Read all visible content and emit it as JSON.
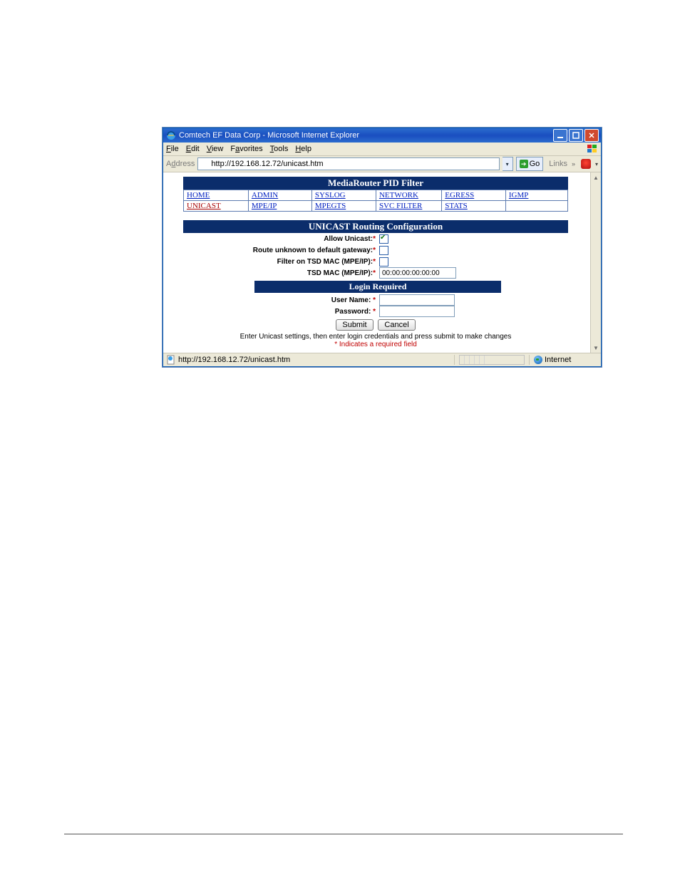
{
  "window": {
    "title": "Comtech EF Data Corp - Microsoft Internet Explorer"
  },
  "menu": {
    "file": "File",
    "edit": "Edit",
    "view": "View",
    "favorites": "Favorites",
    "tools": "Tools",
    "help": "Help"
  },
  "address_bar": {
    "label": "Address",
    "url": "http://192.168.12.72/unicast.htm",
    "go_label": "Go",
    "links_label": "Links"
  },
  "page_header": "MediaRouter PID Filter",
  "nav": {
    "row1": [
      {
        "text": "HOME",
        "cls": ""
      },
      {
        "text": "ADMIN",
        "cls": ""
      },
      {
        "text": "SYSLOG",
        "cls": ""
      },
      {
        "text": "NETWORK",
        "cls": ""
      },
      {
        "text": "EGRESS",
        "cls": ""
      },
      {
        "text": "IGMP",
        "cls": ""
      }
    ],
    "row2": [
      {
        "text": "UNICAST",
        "cls": "red"
      },
      {
        "text": "MPE/IP",
        "cls": ""
      },
      {
        "text": "MPEGTS",
        "cls": ""
      },
      {
        "text": "SVC FILTER",
        "cls": ""
      },
      {
        "text": "STATS",
        "cls": ""
      },
      {
        "text": "",
        "cls": ""
      }
    ]
  },
  "section_header": "UNICAST Routing Configuration",
  "form": {
    "allow_unicast": {
      "label": "Allow Unicast:",
      "checked": true
    },
    "route_unknown": {
      "label": "Route unknown to default gateway:",
      "checked": false
    },
    "filter_tsd": {
      "label": "Filter on TSD MAC (MPE/IP):",
      "checked": false
    },
    "tsd_mac": {
      "label": "TSD MAC (MPE/IP):",
      "value": "00:00:00:00:00:00"
    }
  },
  "login_header": "Login Required",
  "login": {
    "user": {
      "label": "User Name:",
      "value": ""
    },
    "pass": {
      "label": "Password:",
      "value": ""
    }
  },
  "buttons": {
    "submit": "Submit",
    "cancel": "Cancel"
  },
  "help_text": "Enter Unicast settings, then enter login credentials and press submit to make changes",
  "required_text": "* Indicates a required field",
  "status": {
    "url": "http://192.168.12.72/unicast.htm",
    "zone": "Internet"
  }
}
